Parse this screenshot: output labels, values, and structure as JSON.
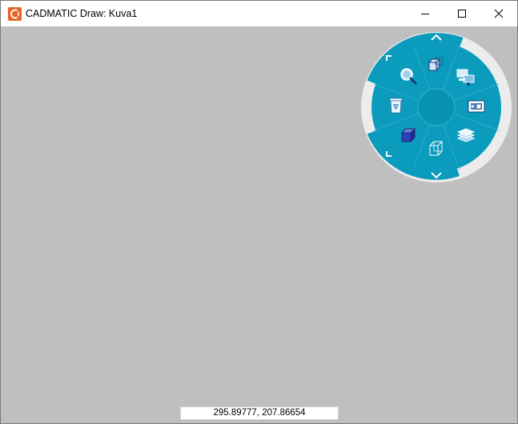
{
  "window": {
    "title": "CADMATIC Draw: Kuva1",
    "app_icon": "cadmatic-logo-icon",
    "controls": [
      "minimize-icon",
      "maximize-icon",
      "close-icon"
    ]
  },
  "canvas": {
    "background": "#bfbfbf"
  },
  "radial_menu": {
    "accent": "#0a9bbd",
    "ring": "#ececec",
    "center": "#0893b3",
    "items": [
      {
        "name": "scroll-up-arrow-icon"
      },
      {
        "name": "3d-view-icon"
      },
      {
        "name": "network-computers-icon"
      },
      {
        "name": "window-view-icon"
      },
      {
        "name": "layers-icon"
      },
      {
        "name": "scroll-down-arrow-icon"
      },
      {
        "name": "open-box-icon"
      },
      {
        "name": "solid-cube-icon"
      },
      {
        "name": "recycle-bin-icon"
      },
      {
        "name": "zoom-icon"
      },
      {
        "name": "corner-top-left-icon"
      },
      {
        "name": "corner-bottom-left-icon"
      }
    ]
  },
  "status": {
    "coordinates": "295.89777, 207.86654"
  }
}
